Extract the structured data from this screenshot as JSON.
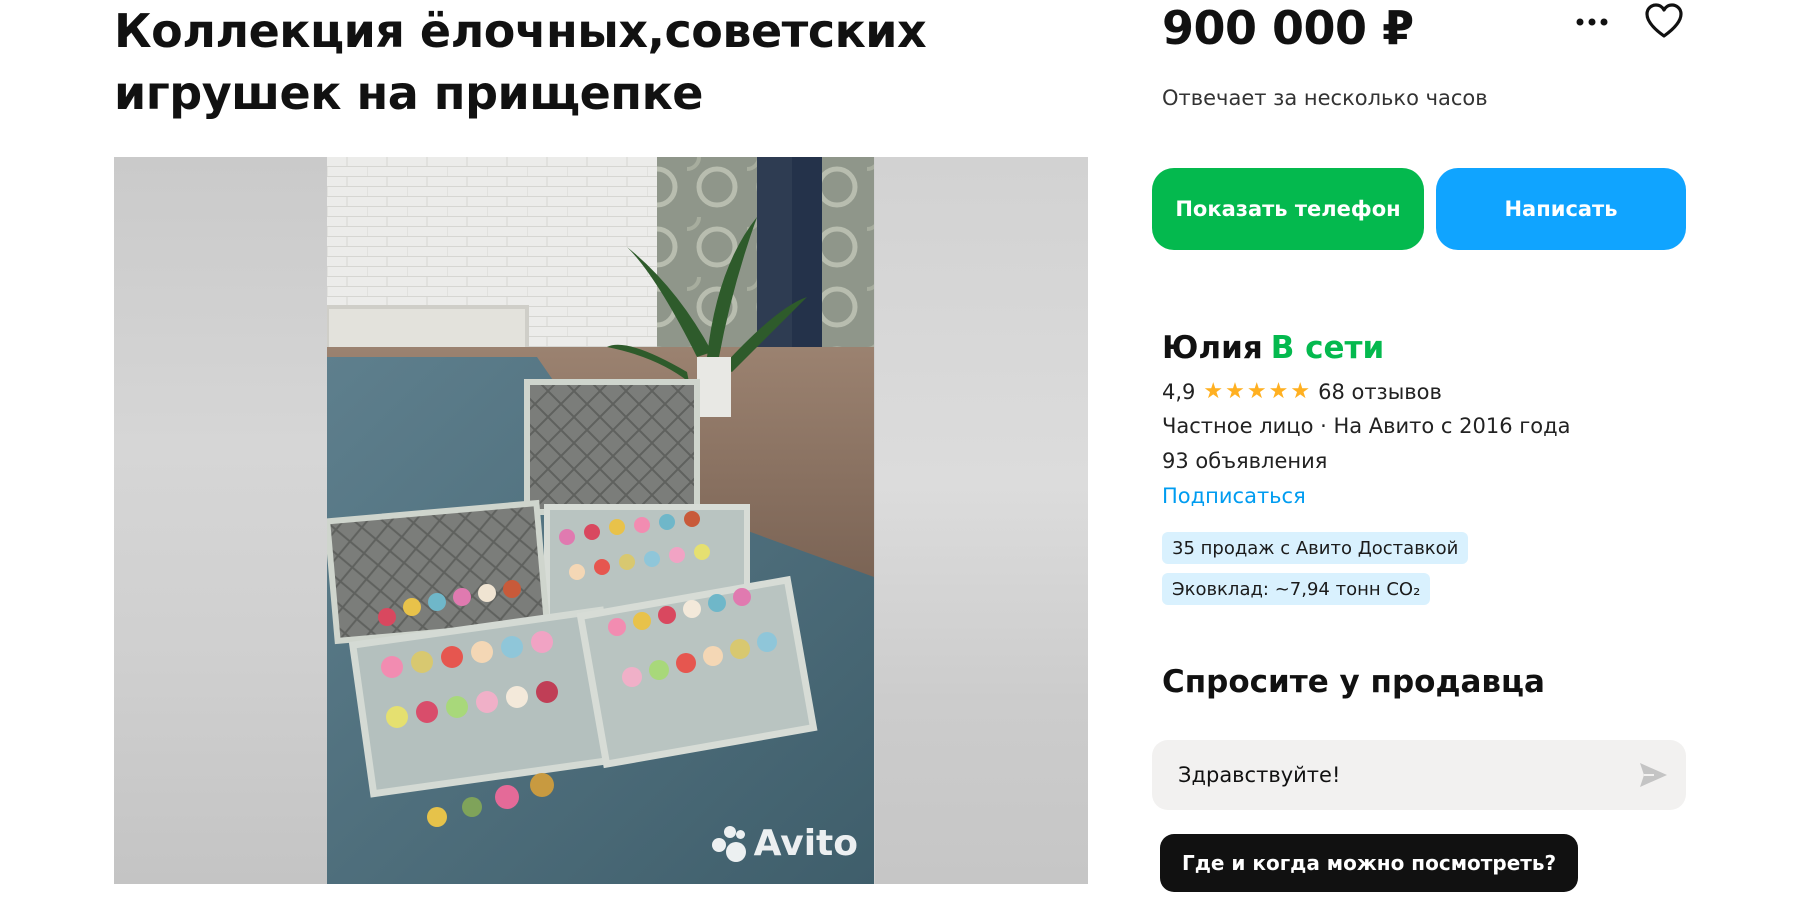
{
  "listing": {
    "title_line1": "Коллекция ёлочных,советских",
    "title_line2": "игрушек на прищепке",
    "price": "900 000 ₽",
    "reply_time": "Отвечает за несколько часов",
    "photo_watermark": "Avito"
  },
  "actions": {
    "show_phone": "Показать телефон",
    "write": "Написать",
    "more_icon": "more-dots-icon",
    "favorite_icon": "heart-outline-icon"
  },
  "seller": {
    "name": "Юлия",
    "status": "В сети",
    "rating": "4,9",
    "stars_filled": 5,
    "stars_total": 5,
    "reviews": "68 отзывов",
    "type_since": "Частное лицо · На Авито с 2016 года",
    "listings_count": "93 объявления",
    "subscribe": "Подписаться",
    "badge_delivery": "35 продаж с Авито Доставкой",
    "badge_eco": "Эковклад: ~7,94 тонн CO₂"
  },
  "ask": {
    "heading": "Спросите у продавца",
    "message_value": "Здравствуйте!",
    "quick_question": "Где и когда можно посмотреть?"
  },
  "colors": {
    "green": "#04b94e",
    "blue": "#10a4ff",
    "link": "#009cf0",
    "star": "#ffb021",
    "badge_bg": "#d9f1fe"
  }
}
